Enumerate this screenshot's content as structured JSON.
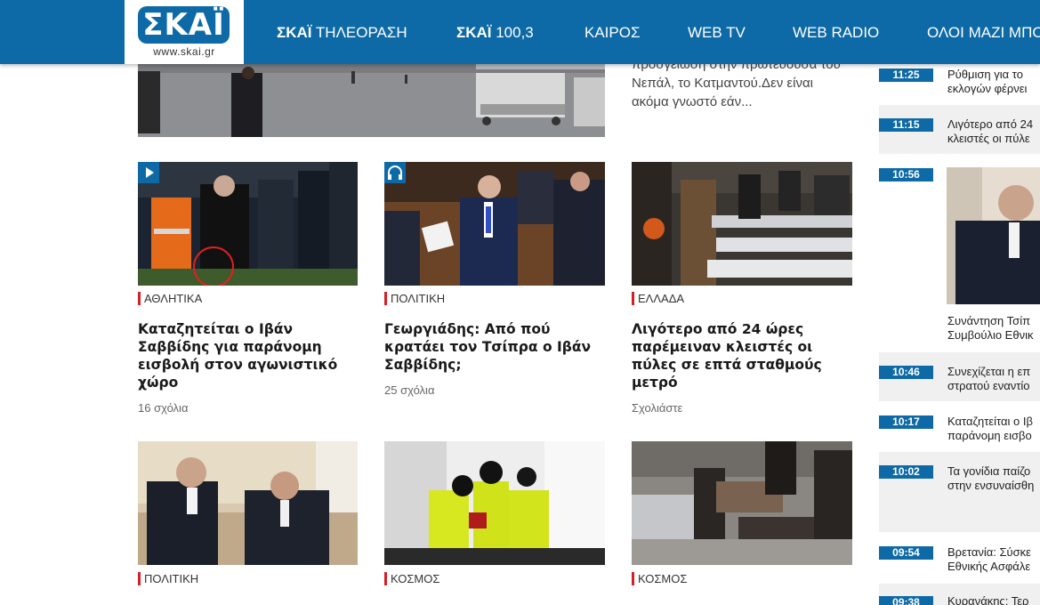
{
  "header": {
    "logo_text": "ΣΚΑΪ",
    "logo_url": "www.skai.gr",
    "brand_color": "#0d6aa6",
    "nav": [
      {
        "brand": "ΣΚΑΪ",
        "label": "ΤΗΛΕΟΡΑΣΗ"
      },
      {
        "brand": "ΣΚΑΪ",
        "label": "100,3"
      },
      {
        "brand": "",
        "label": "ΚΑΙΡΟΣ"
      },
      {
        "brand": "",
        "label": "WEB TV"
      },
      {
        "brand": "",
        "label": "WEB RADIO"
      },
      {
        "brand": "",
        "label": "ΟΛΟΙ ΜΑΖΙ ΜΠΟ"
      }
    ]
  },
  "top_story": {
    "teaser_lines": [
      "προσγείωση στην πρωτεύουσα του",
      "Νεπάλ, το Κατμαντού.Δεν είναι",
      "ακόμα γνωστό εάν..."
    ]
  },
  "cards_row1": [
    {
      "category": "ΑΘΛΗΤΙΚΑ",
      "title": "Καταζητείται ο Ιβάν Σαββίδης για παράνομη εισβολή στον αγωνιστικό χώρο",
      "comments": "16 σχόλια",
      "media": "play-icon"
    },
    {
      "category": "ΠΟΛΙΤΙΚΗ",
      "title": "Γεωργιάδης: Από πού κρατάει τον Τσίπρα ο Ιβάν Σαββίδης;",
      "comments": "25 σχόλια",
      "media": "headphones-icon"
    },
    {
      "category": "ΕΛΛΑΔΑ",
      "title": "Λιγότερο από 24 ώρες παρέμειναν κλειστές οι πύλες σε επτά σταθμούς μετρό",
      "comments": "Σχολιάστε",
      "media": ""
    }
  ],
  "cards_row2": [
    {
      "category": "ΠΟΛΙΤΙΚΗ"
    },
    {
      "category": "ΚΟΣΜΟΣ"
    },
    {
      "category": "ΚΟΣΜΟΣ"
    }
  ],
  "ticker": [
    {
      "time": "11:25",
      "line1": "Ρύθμιση για το",
      "line2": "εκλογών φέρνει"
    },
    {
      "time": "11:15",
      "line1": "Λιγότερο από 24",
      "line2": "κλειστές οι πύλε"
    },
    {
      "time": "10:56",
      "line1": "Συνάντηση Τσίπ",
      "line2": "Συμβούλιο Εθνικ"
    },
    {
      "time": "10:46",
      "line1": "Συνεχίζεται η επ",
      "line2": "στρατού εναντίο"
    },
    {
      "time": "10:17",
      "line1": "Καταζητείται ο Ιβ",
      "line2": "παράνομη εισβο"
    },
    {
      "time": "10:02",
      "line1": "Τα γονίδια παίζο",
      "line2": "στην ενσυναίσθη"
    },
    {
      "time": "09:54",
      "line1": "Βρετανία: Σύσκε",
      "line2": "Εθνικής Ασφάλε"
    },
    {
      "time": "09:38",
      "line1": "Κυρανάκης: Τερ",
      "line2": ""
    }
  ]
}
